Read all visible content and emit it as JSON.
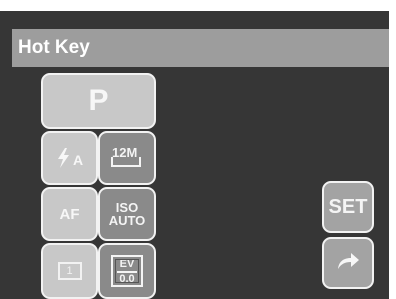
{
  "header": {
    "title": "Hot Key"
  },
  "buttons": {
    "mode": "P",
    "flash_mode": "A",
    "resolution": "12M",
    "focus": "AF",
    "iso_top": "ISO",
    "iso_bottom": "AUTO",
    "drive": "1",
    "ev_top": "EV",
    "ev_bottom": "0.0",
    "set": "SET"
  },
  "icons": {
    "flash": "flash-auto-icon",
    "resolution": "image-size-icon",
    "return": "return-arrow-icon"
  }
}
